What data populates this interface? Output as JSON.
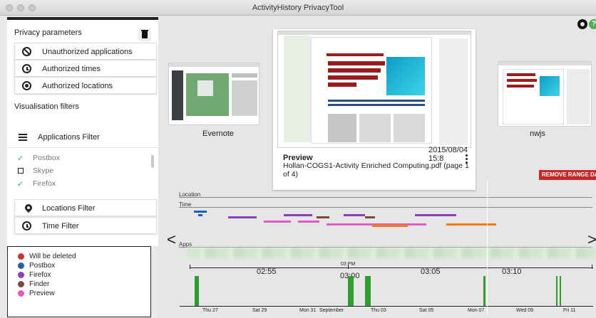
{
  "window": {
    "title": "ActivityHistory PrivacyTool"
  },
  "privacy": {
    "title": "Privacy parameters",
    "items": [
      {
        "label": "Unauthorized applications",
        "icon": "ban-icon"
      },
      {
        "label": "Authorized times",
        "icon": "clock-icon"
      },
      {
        "label": "Authorized locations",
        "icon": "gps-target-icon"
      }
    ]
  },
  "filters": {
    "title": "Visualisation filters",
    "applications_label": "Applications Filter",
    "apps": [
      {
        "name": "Postbox",
        "state": "checked"
      },
      {
        "name": "Skype",
        "state": "unchecked"
      },
      {
        "name": "Firefox",
        "state": "checked"
      }
    ],
    "locations_label": "Locations Filter",
    "time_label": "Time Filter"
  },
  "legend": [
    {
      "label": "Will be deleted",
      "color": "#d32f2f"
    },
    {
      "label": "Postbox",
      "color": "#1e5fae"
    },
    {
      "label": "Firefox",
      "color": "#8e3fb8"
    },
    {
      "label": "Finder",
      "color": "#7a4a3a"
    },
    {
      "label": "Preview",
      "color": "#e15bc7"
    }
  ],
  "carousel": {
    "left_label": "Evernote",
    "right_label": "nwjs",
    "center": {
      "timestamp": "2015/08/04 15:8",
      "title": "Preview",
      "subtitle": "Hollan-COGS1-Activity Enriched Computing.pdf (page 1 of 4)",
      "doc_title": "Activity-Enriched Computing: Capturing and Mining Activity Histories",
      "doc_section": "INVISIBLE COMPUTING"
    }
  },
  "actions": {
    "remove_range": "REMOVE RANGE DATA"
  },
  "timeline": {
    "tracks": [
      "Location",
      "Time",
      "Apps"
    ],
    "hours": [
      "02:55",
      "03:00",
      "03:05",
      "03:10"
    ],
    "hour_mark_small": "03 PM",
    "dates": [
      "Thu 27",
      "Sat 29",
      "Mon 31",
      "September",
      "Thu 03",
      "Sat 05",
      "Mon 07",
      "Wed 09",
      "Fri 11"
    ]
  },
  "colors": {
    "accent_green": "#2e9e2e",
    "remove_red": "#c62828"
  }
}
